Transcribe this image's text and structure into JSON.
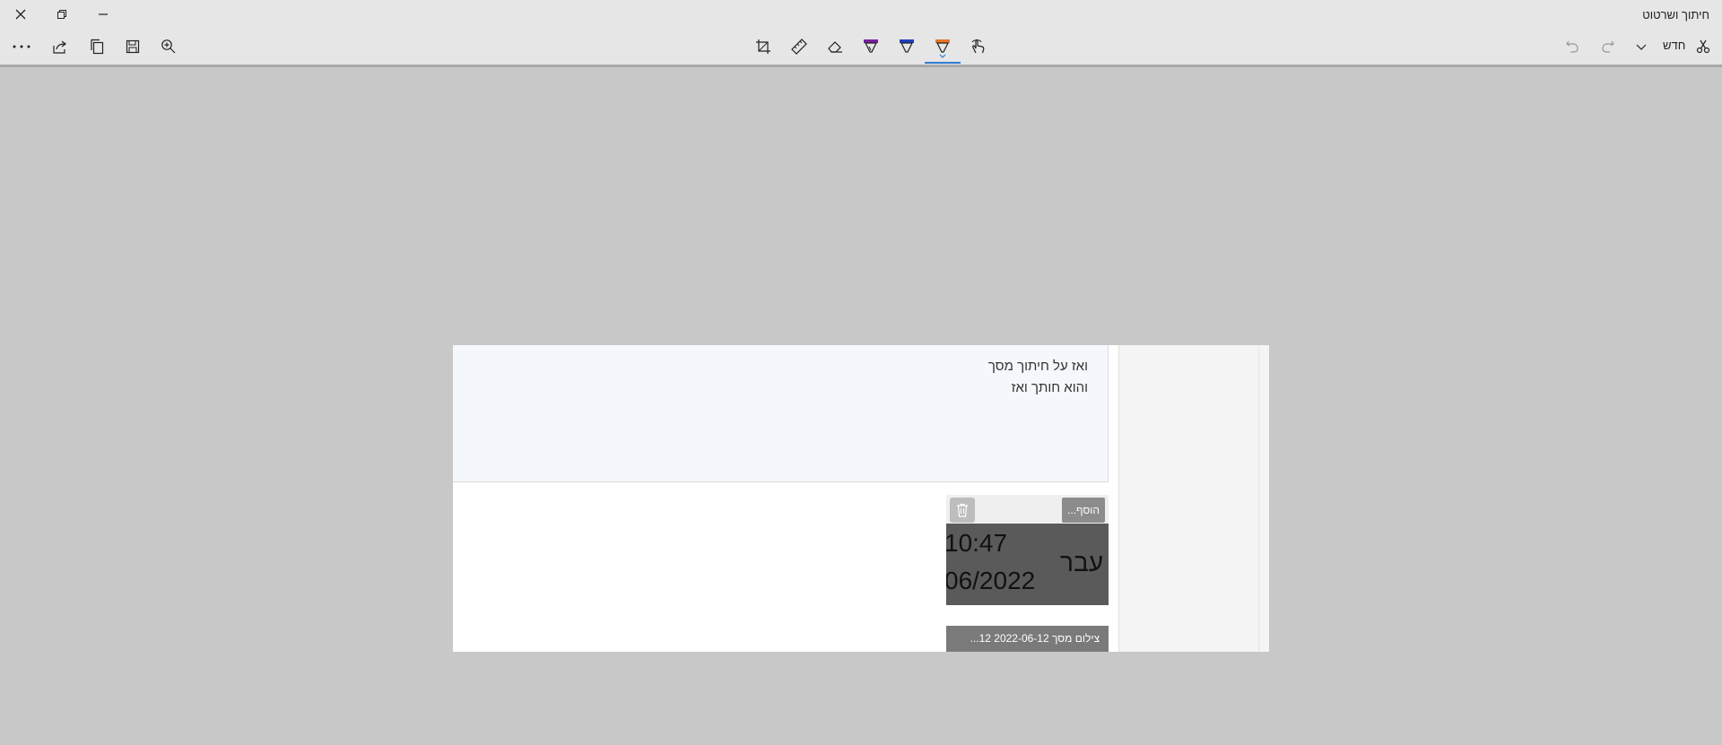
{
  "window": {
    "title": "חיתוך ושרטוט"
  },
  "toolbar": {
    "new_label": "חדש",
    "active_tool": "ballpoint-pen",
    "pen_colors": {
      "ballpoint": "#7a1fa2",
      "pencil": "#1f3fbf",
      "highlighter": "#e8742a"
    },
    "accent_color": "#2f7bd1"
  },
  "capture": {
    "message_lines": [
      "ואז על חיתוך מסך",
      "והוא חותך ואז"
    ],
    "attachment": {
      "more_label": "הוסף...",
      "thumbnail_time": "10:47",
      "thumbnail_date": "06/2022",
      "thumbnail_word": "עבר",
      "file_caption": "צילום מסך 2022-06-12 12..."
    }
  }
}
